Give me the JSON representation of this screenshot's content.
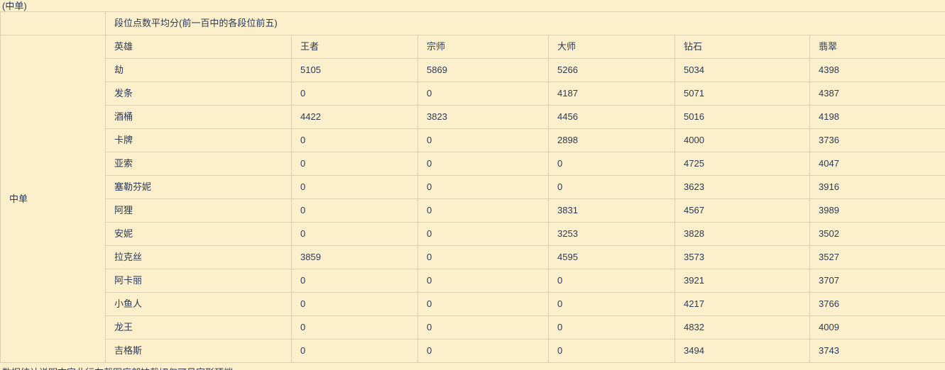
{
  "page": {
    "caption": "(中单)",
    "background_color": "#FCEFCB",
    "border_color": "#DDD0B0",
    "text_color": "#2b3a55"
  },
  "table": {
    "group_label": "中单",
    "section_title": "段位点数平均分(前一百中的各段位前五)",
    "columns": [
      {
        "key": "hero",
        "label": "英雄"
      },
      {
        "key": "king",
        "label": "王者"
      },
      {
        "key": "gm",
        "label": "宗师"
      },
      {
        "key": "master",
        "label": "大师"
      },
      {
        "key": "diamond",
        "label": "钻石"
      },
      {
        "key": "emerald",
        "label": "翡翠"
      }
    ],
    "rows": [
      {
        "hero": "劫",
        "king": "5105",
        "gm": "5869",
        "master": "5266",
        "diamond": "5034",
        "emerald": "4398"
      },
      {
        "hero": "发条",
        "king": "0",
        "gm": "0",
        "master": "4187",
        "diamond": "5071",
        "emerald": "4387"
      },
      {
        "hero": "酒桶",
        "king": "4422",
        "gm": "3823",
        "master": "4456",
        "diamond": "5016",
        "emerald": "4198"
      },
      {
        "hero": "卡牌",
        "king": "0",
        "gm": "0",
        "master": "2898",
        "diamond": "4000",
        "emerald": "3736"
      },
      {
        "hero": "亚索",
        "king": "0",
        "gm": "0",
        "master": "0",
        "diamond": "4725",
        "emerald": "4047"
      },
      {
        "hero": "塞勒芬妮",
        "king": "0",
        "gm": "0",
        "master": "0",
        "diamond": "3623",
        "emerald": "3916"
      },
      {
        "hero": "阿狸",
        "king": "0",
        "gm": "0",
        "master": "3831",
        "diamond": "4567",
        "emerald": "3989"
      },
      {
        "hero": "安妮",
        "king": "0",
        "gm": "0",
        "master": "3253",
        "diamond": "3828",
        "emerald": "3502"
      },
      {
        "hero": "拉克丝",
        "king": "3859",
        "gm": "0",
        "master": "4595",
        "diamond": "3573",
        "emerald": "3527"
      },
      {
        "hero": "阿卡丽",
        "king": "0",
        "gm": "0",
        "master": "0",
        "diamond": "3921",
        "emerald": "3707"
      },
      {
        "hero": "小鱼人",
        "king": "0",
        "gm": "0",
        "master": "0",
        "diamond": "4217",
        "emerald": "3766"
      },
      {
        "hero": "龙王",
        "king": "0",
        "gm": "0",
        "master": "0",
        "diamond": "4832",
        "emerald": "4009"
      },
      {
        "hero": "吉格斯",
        "king": "0",
        "gm": "0",
        "master": "0",
        "diamond": "3494",
        "emerald": "3743"
      }
    ]
  },
  "footnote": {
    "clipped_text": "数据统计说明文字此行在截图底部被裁切仅可见字形顶端"
  }
}
